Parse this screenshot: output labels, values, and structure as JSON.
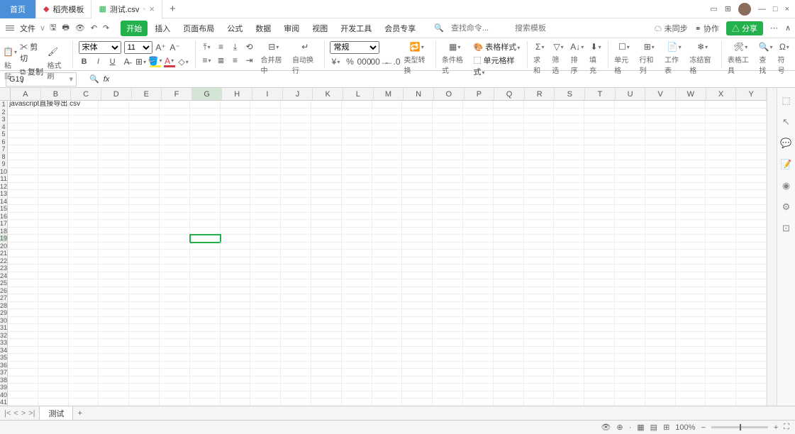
{
  "titlebar": {
    "home_tab": "首页",
    "template_tab": "稻壳模板",
    "file_tab": "测试.csv",
    "plus": "+"
  },
  "menubar": {
    "file_label": "文件",
    "tabs": [
      "开始",
      "插入",
      "页面布局",
      "公式",
      "数据",
      "审阅",
      "视图",
      "开发工具",
      "会员专享"
    ],
    "active_tab": 0,
    "search_placeholder1": "查找命令...",
    "search_placeholder2": "搜索模板",
    "sync": "未同步",
    "collab": "协作",
    "share": "分享"
  },
  "ribbon": {
    "paste": "粘贴",
    "cut": "剪切",
    "copy": "复制",
    "format_painter": "格式刷",
    "font_name": "宋体",
    "font_size": "11",
    "merge": "合并居中",
    "wrap": "自动换行",
    "number_format": "常规",
    "type_convert": "类型转换",
    "cond_format": "条件格式",
    "table_style": "表格样式",
    "cell_style": "单元格样式",
    "sum": "求和",
    "filter": "筛选",
    "sort": "排序",
    "fill": "填充",
    "cell": "单元格",
    "row_col": "行和列",
    "worksheet": "工作表",
    "freeze": "冻结窗格",
    "table_tools": "表格工具",
    "find": "查找",
    "symbol": "符号"
  },
  "namebox": {
    "cell_ref": "G19"
  },
  "grid": {
    "columns": [
      "A",
      "B",
      "C",
      "D",
      "E",
      "F",
      "G",
      "H",
      "I",
      "J",
      "K",
      "L",
      "M",
      "N",
      "O",
      "P",
      "Q",
      "R",
      "S",
      "T",
      "U",
      "V",
      "W",
      "X",
      "Y"
    ],
    "row_count": 44,
    "selected_col": 6,
    "selected_row": 19,
    "cells": {
      "A1": "javascript直接导出.csv"
    }
  },
  "sheetbar": {
    "sheet_name": "测试"
  },
  "statusbar": {
    "zoom": "100%"
  }
}
